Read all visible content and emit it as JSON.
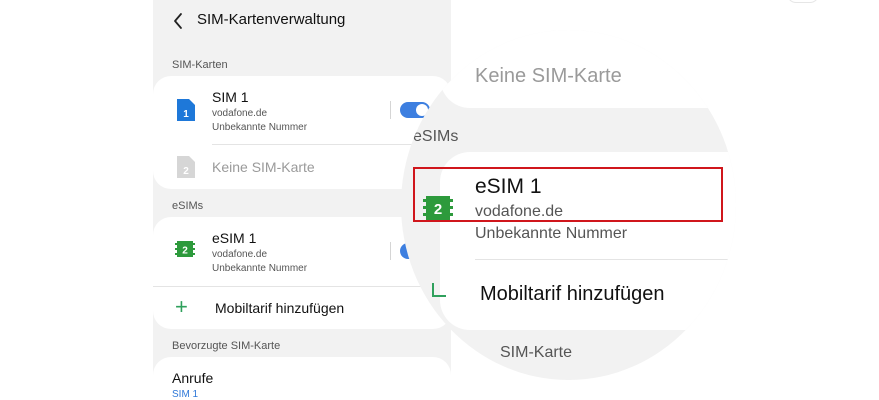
{
  "header": {
    "title": "SIM-Kartenverwaltung"
  },
  "sections": {
    "sim_cards": "SIM-Karten",
    "esims": "eSIMs",
    "preferred": "Bevorzugte SIM-Karte"
  },
  "sim1": {
    "name": "SIM 1",
    "carrier": "vodafone.de",
    "number": "Unbekannte Nummer",
    "slot": "1",
    "toggle": "on"
  },
  "sim2": {
    "name": "Keine SIM-Karte",
    "slot": "2"
  },
  "esim1": {
    "name": "eSIM 1",
    "carrier": "vodafone.de",
    "number": "Unbekannte Nummer",
    "slot": "2",
    "toggle": "on"
  },
  "add_plan": {
    "label": "Mobiltarif hinzufügen"
  },
  "preferred": {
    "label": "Anrufe",
    "value": "SIM 1"
  },
  "zoom": {
    "no_sim": "Keine SIM-Karte",
    "esims": "eSIMs",
    "esim_name": "eSIM 1",
    "esim_carrier": "vodafone.de",
    "esim_number": "Unbekannte Nummer",
    "esim_slot": "2",
    "add_plan": "Mobiltarif hinzufügen",
    "pref_partial": "SIM-Karte"
  },
  "colors": {
    "accent_blue": "#3d7fe0",
    "sim_blue": "#1e78d9",
    "esim_green": "#2d9a3c",
    "highlight_red": "#d0161c"
  }
}
